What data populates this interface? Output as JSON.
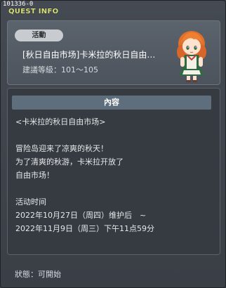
{
  "quest_id": "101336-0",
  "window_title": "QUEST INFO",
  "header": {
    "badge": "活動",
    "quest_name": "[秋日自由市场]卡米拉的秋日自由…",
    "level_text": "建議等級：101～105"
  },
  "content": {
    "section_title": "內容",
    "lines": [
      "<卡米拉的秋日自由市场>",
      "",
      "冒险岛迎来了凉爽的秋天！",
      "为了清爽的秋游，卡米拉开放了",
      "自由市场！",
      "",
      "活动时间",
      "2022年10月27日（周四）维护后　~",
      "2022年11月9日（周三）下午11点59分"
    ]
  },
  "status_text": "狀態：可開始",
  "npc_icon": "orange-haired-girl-npc",
  "colors": {
    "title": "#d8e07a",
    "section_bar": "#5f6e7c",
    "badge": "#c8ccd0"
  }
}
